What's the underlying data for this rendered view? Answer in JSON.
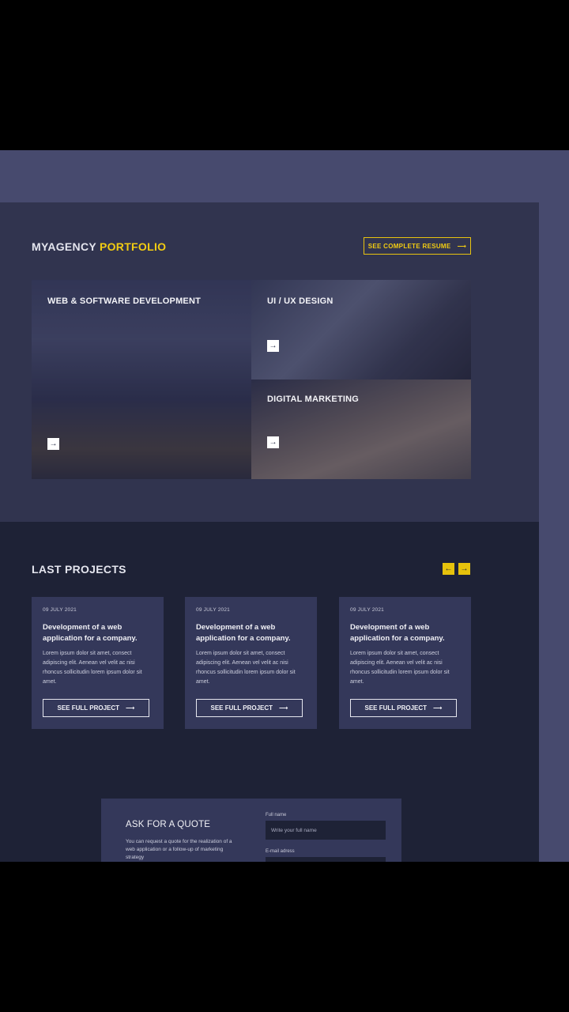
{
  "portfolio": {
    "title_prefix": "MYAGENCY",
    "title_accent": "PORTFOLIO",
    "resume_label": "SEE COMPLETE RESUME",
    "accent_color": "#f2cc12",
    "tiles": [
      {
        "label": "WEB & SOFTWARE DEVELOPMENT"
      },
      {
        "label": "UI / UX DESIGN"
      },
      {
        "label": "DIGITAL MARKETING"
      }
    ]
  },
  "projects": {
    "title": "LAST PROJECTS",
    "cards": [
      {
        "date": "09 JULY 2021",
        "title": "Development of a web application for a company.",
        "desc": "Lorem ipsum dolor sit amet, consect adipiscing elit. Aenean vel velit ac nisi rhoncus sollicitudin lorem ipsum dolor sit amet.",
        "cta": "SEE FULL PROJECT"
      },
      {
        "date": "09 JULY 2021",
        "title": "Development of a web application for a company.",
        "desc": "Lorem ipsum dolor sit amet, consect adipiscing elit. Aenean vel velit ac nisi rhoncus sollicitudin lorem ipsum dolor sit amet.",
        "cta": "SEE FULL PROJECT"
      },
      {
        "date": "09 JULY 2021",
        "title": "Development of a web application for a company.",
        "desc": "Lorem ipsum dolor sit amet, consect adipiscing elit. Aenean vel velit ac nisi rhoncus sollicitudin lorem ipsum dolor sit amet.",
        "cta": "SEE FULL PROJECT"
      }
    ]
  },
  "quote": {
    "title": "ASK FOR A QUOTE",
    "desc": "You can request a quote for the realization of a web application or a follow-up of marketing strategy",
    "fullname_label": "Full name",
    "fullname_placeholder": "Write your full name",
    "email_label": "E-mail adress"
  }
}
